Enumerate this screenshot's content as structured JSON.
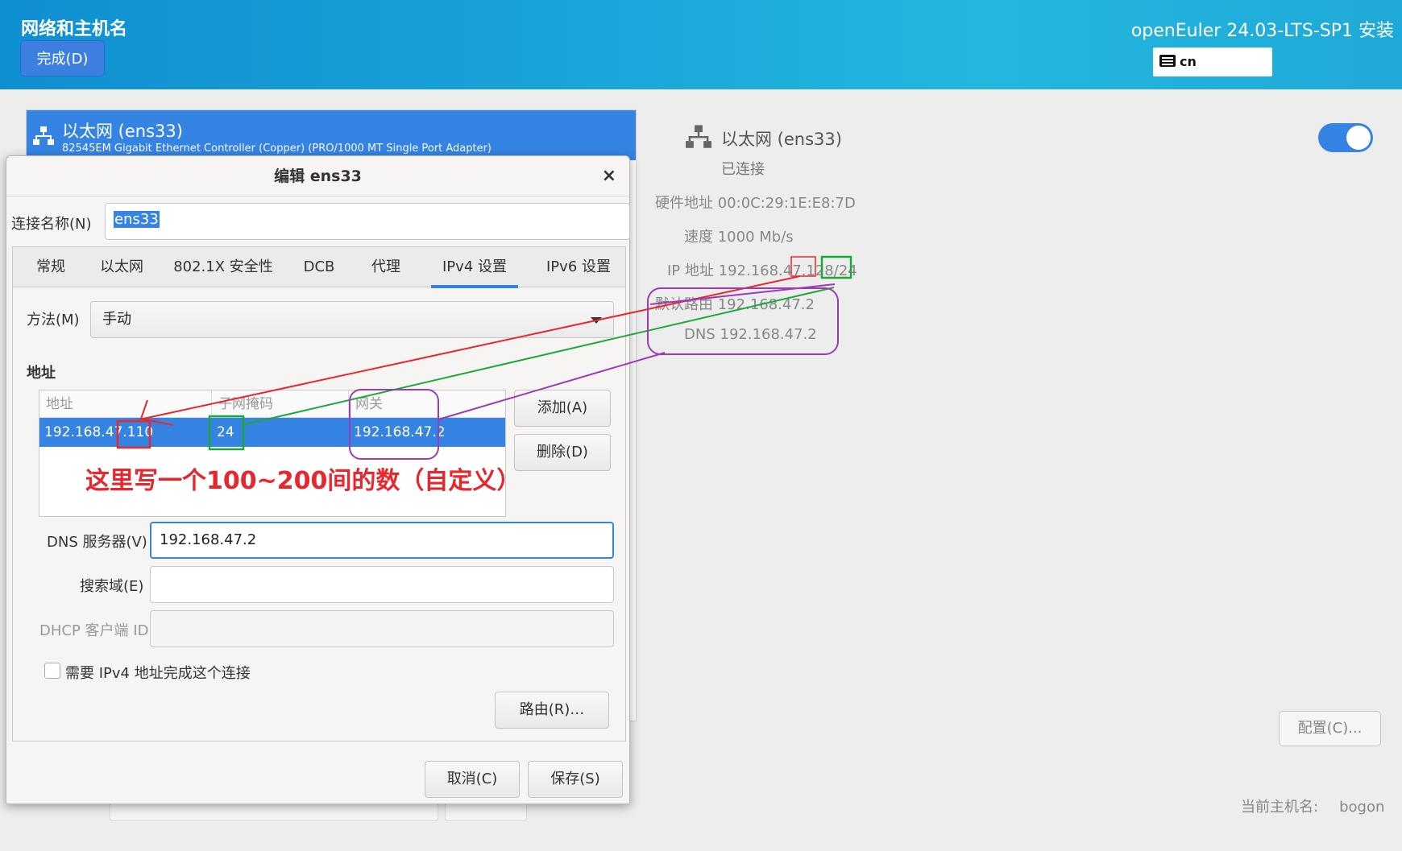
{
  "header": {
    "title": "网络和主机名",
    "done_button": "完成(D)",
    "product": "openEuler 24.03-LTS-SP1 安装",
    "keyboard_layout": "cn"
  },
  "device_list": {
    "items": [
      {
        "title": "以太网 (ens33)",
        "subtitle": "82545EM Gigabit Ethernet Controller (Copper) (PRO/1000 MT Single Port Adapter)"
      }
    ]
  },
  "details": {
    "title": "以太网 (ens33)",
    "status": "已连接",
    "rows": [
      {
        "label": "硬件地址",
        "value": "00:0C:29:1E:E8:7D"
      },
      {
        "label": "速度",
        "value": "1000 Mb/s"
      },
      {
        "label": "IP 地址",
        "value": "192.168.47.128/24"
      },
      {
        "label": "默认路由",
        "value": "192.168.47.2"
      },
      {
        "label": "DNS",
        "value": "192.168.47.2"
      }
    ],
    "toggle_on": true,
    "config_button": "配置(C)...",
    "hostname_label": "当前主机名:",
    "hostname_value": "bogon"
  },
  "dialog": {
    "title": "编辑 ens33",
    "close": "×",
    "connection_name_label": "连接名称(N)",
    "connection_name": "ens33",
    "tabs": [
      "常规",
      "以太网",
      "802.1X 安全性",
      "DCB",
      "代理",
      "IPv4 设置",
      "IPv6 设置"
    ],
    "active_tab": "IPv4 设置",
    "method_label": "方法(M)",
    "method": "手动",
    "addresses_label": "地址",
    "columns": [
      "地址",
      "子网掩码",
      "网关"
    ],
    "rows": [
      [
        "192.168.47.110",
        "24",
        "192.168.47.2"
      ]
    ],
    "add_button": "添加(A)",
    "delete_button": "删除(D)",
    "dns_label": "DNS 服务器(V)",
    "dns_value": "192.168.47.2",
    "search_label": "搜索域(E)",
    "search_value": "",
    "dhcp_label": "DHCP 客户端 ID",
    "dhcp_value": "",
    "require_ipv4_label": "需要 IPv4 地址完成这个连接",
    "routes_button": "路由(R)…",
    "cancel_button": "取消(C)",
    "save_button": "保存(S)"
  },
  "annotation": {
    "text": "这里写一个100~200间的数（自定义）",
    "colors": {
      "red": "#e8262b",
      "green": "#1fa83a",
      "purple": "#9b3bb5"
    }
  }
}
